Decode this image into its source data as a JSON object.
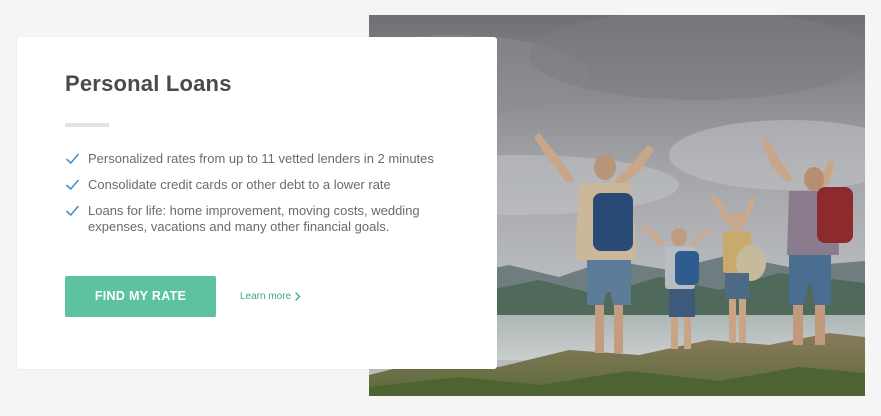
{
  "card": {
    "title": "Personal Loans",
    "features": [
      "Personalized rates from up to 11 vetted lenders in 2 minutes",
      "Consolidate credit cards or other debt to a lower rate",
      "Loans for life: home improvement, moving costs, wedding expenses, vacations and many other financial goals."
    ],
    "cta_label": "FIND MY RATE",
    "learn_more_label": "Learn more"
  },
  "colors": {
    "accent": "#5cc2a0",
    "link": "#3fa98a",
    "check": "#4a90c8",
    "title": "#4a4a4a",
    "body_text": "#6b6b6b",
    "page_bg": "#f5f5f5"
  },
  "icons": {
    "feature_bullet": "check-icon",
    "learn_more": "chevron-right-icon"
  }
}
